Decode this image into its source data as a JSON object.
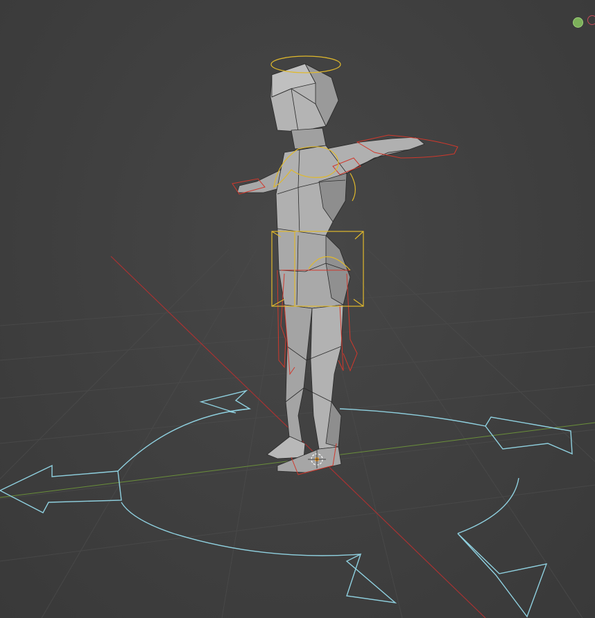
{
  "viewport": {
    "background_color": "#3d3d3d",
    "grid_color": "#4a4a4a",
    "x_axis_color": "#a83232",
    "y_axis_color": "#6a8f3a"
  },
  "scene": {
    "mesh_color": "#a9a9a9",
    "mesh_edge_color": "#2a2a2a",
    "bone_widget_color": "#d1382c",
    "selected_widget_color": "#e0b92c",
    "root_widget_color": "#8fd0df"
  },
  "nav_gizmo": {
    "y_axis_color": "#7cb05a",
    "x_axis_color": "#c94a5a"
  },
  "icons": {
    "origin": "origin-pivot-icon"
  }
}
